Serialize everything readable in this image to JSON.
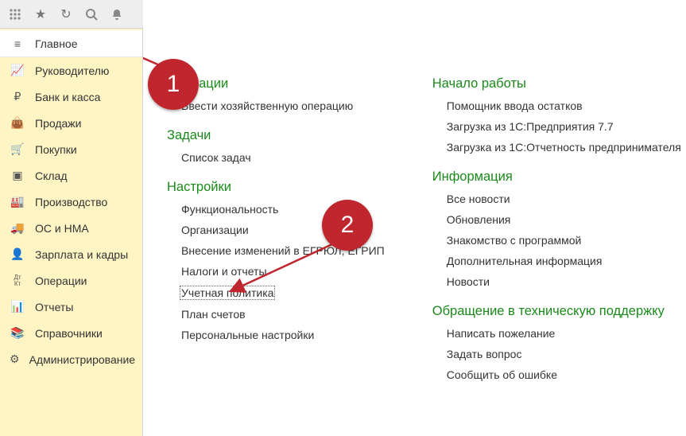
{
  "toolbar": {
    "apps_icon": "apps-icon",
    "star_icon": "star-icon",
    "history_icon": "history-icon",
    "search_icon": "search-icon",
    "bell_icon": "bell-icon"
  },
  "sidebar": {
    "items": [
      {
        "label": "Главное",
        "icon": "menu-icon",
        "name": "sidebar-item-main",
        "active": true
      },
      {
        "label": "Руководителю",
        "icon": "chart-up-icon",
        "name": "sidebar-item-manager"
      },
      {
        "label": "Банк и касса",
        "icon": "ruble-icon",
        "name": "sidebar-item-bank"
      },
      {
        "label": "Продажи",
        "icon": "bag-icon",
        "name": "sidebar-item-sales"
      },
      {
        "label": "Покупки",
        "icon": "cart-icon",
        "name": "sidebar-item-purchases"
      },
      {
        "label": "Склад",
        "icon": "boxes-icon",
        "name": "sidebar-item-warehouse"
      },
      {
        "label": "Производство",
        "icon": "factory-icon",
        "name": "sidebar-item-production"
      },
      {
        "label": "ОС и НМА",
        "icon": "truck-icon",
        "name": "sidebar-item-assets"
      },
      {
        "label": "Зарплата и кадры",
        "icon": "person-icon",
        "name": "sidebar-item-hr"
      },
      {
        "label": "Операции",
        "icon": "dtkt-icon",
        "name": "sidebar-item-operations"
      },
      {
        "label": "Отчеты",
        "icon": "bars-icon",
        "name": "sidebar-item-reports"
      },
      {
        "label": "Справочники",
        "icon": "books-icon",
        "name": "sidebar-item-catalogs"
      },
      {
        "label": "Администрирование",
        "icon": "gear-icon",
        "name": "sidebar-item-admin"
      }
    ]
  },
  "content": {
    "left": [
      {
        "title": "Операции",
        "first": true,
        "links": [
          {
            "label": "Ввести хозяйственную операцию",
            "name": "link-enter-operation"
          }
        ]
      },
      {
        "title": "Задачи",
        "links": [
          {
            "label": "Список задач",
            "name": "link-task-list"
          }
        ]
      },
      {
        "title": "Настройки",
        "links": [
          {
            "label": "Функциональность",
            "name": "link-functionality"
          },
          {
            "label": "Организации",
            "name": "link-organizations"
          },
          {
            "label": "Внесение изменений в ЕГРЮЛ, ЕГРИП",
            "name": "link-egr-changes"
          },
          {
            "label": "Налоги и отчеты",
            "name": "link-taxes-reports"
          },
          {
            "label": "Учетная политика",
            "name": "link-accounting-policy",
            "focused": true
          },
          {
            "label": "План счетов",
            "name": "link-chart-of-accounts"
          },
          {
            "label": "Персональные настройки",
            "name": "link-personal-settings"
          }
        ]
      }
    ],
    "right": [
      {
        "title": "Начало работы",
        "first": true,
        "links": [
          {
            "label": "Помощник ввода остатков",
            "name": "link-balance-wizard"
          },
          {
            "label": "Загрузка из 1С:Предприятия 7.7",
            "name": "link-load-1c77"
          },
          {
            "label": "Загрузка из 1С:Отчетность предпринимателя",
            "name": "link-load-1c-report"
          }
        ]
      },
      {
        "title": "Информация",
        "links": [
          {
            "label": "Все новости",
            "name": "link-all-news"
          },
          {
            "label": "Обновления",
            "name": "link-updates"
          },
          {
            "label": "Знакомство с программой",
            "name": "link-intro"
          },
          {
            "label": "Дополнительная информация",
            "name": "link-extra-info"
          },
          {
            "label": "Новости",
            "name": "link-news"
          }
        ]
      },
      {
        "title": "Обращение в техническую поддержку",
        "links": [
          {
            "label": "Написать пожелание",
            "name": "link-write-wish"
          },
          {
            "label": "Задать вопрос",
            "name": "link-ask-question"
          },
          {
            "label": "Сообщить об ошибке",
            "name": "link-report-bug"
          }
        ]
      }
    ]
  },
  "annotations": {
    "badge1": "1",
    "badge2": "2"
  },
  "icons_glyph": {
    "menu-icon": "≡",
    "chart-up-icon": "📈",
    "ruble-icon": "₽",
    "bag-icon": "👜",
    "cart-icon": "🛒",
    "boxes-icon": "▣",
    "factory-icon": "🏭",
    "truck-icon": "🚚",
    "person-icon": "👤",
    "dtkt-icon": "Дт/Кт",
    "bars-icon": "📊",
    "books-icon": "📚",
    "gear-icon": "⚙"
  }
}
